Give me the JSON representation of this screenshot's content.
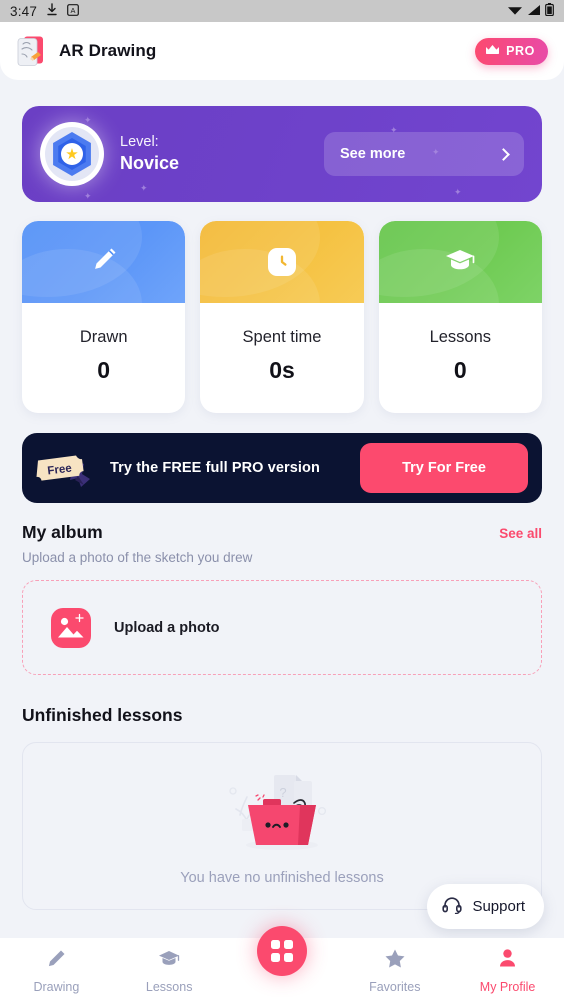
{
  "status_bar": {
    "time": "3:47",
    "icons_left": [
      "download-icon",
      "a-badge-icon"
    ],
    "icons_right": [
      "wifi-icon",
      "signal-icon",
      "battery-icon"
    ]
  },
  "header": {
    "app_icon": "ar-drawing-app-icon",
    "title": "AR Drawing",
    "pro_label": "PRO",
    "pro_icon": "crown-icon",
    "pro_color": "#f2479a"
  },
  "level_card": {
    "badge_icon": "level-badge-star-icon",
    "label": "Level:",
    "value": "Novice",
    "button_label": "See more",
    "button_icon": "chevron-right-icon",
    "bg_color": "#6d41c9"
  },
  "stats": [
    {
      "icon": "pencil-icon",
      "label": "Drawn",
      "value": "0",
      "color": "#4f8ef7"
    },
    {
      "icon": "clock-icon",
      "label": "Spent time",
      "value": "0s",
      "color": "#f2b731"
    },
    {
      "icon": "graduation-cap-icon",
      "label": "Lessons",
      "value": "0",
      "color": "#62c447"
    }
  ],
  "promo": {
    "ticket_icon": "free-ticket-icon",
    "ticket_text": "Free",
    "text": "Try the FREE full PRO version",
    "button_label": "Try For Free",
    "bg_color": "#0b1332",
    "button_color": "#fc4a6e"
  },
  "album": {
    "title": "My album",
    "see_all": "See all",
    "subtitle": "Upload a photo of the sketch you drew",
    "upload_icon": "add-photo-icon",
    "upload_label": "Upload a photo"
  },
  "unfinished": {
    "title": "Unfinished lessons",
    "illustration": "empty-basket-illustration",
    "empty_text": "You have no unfinished lessons"
  },
  "support": {
    "icon": "headset-icon",
    "label": "Support"
  },
  "bottom_nav": {
    "items": [
      {
        "icon": "pencil-icon",
        "label": "Drawing",
        "active": false
      },
      {
        "icon": "graduation-cap-icon",
        "label": "Lessons",
        "active": false
      },
      {
        "icon": "grid-icon",
        "label": "",
        "active": false
      },
      {
        "icon": "star-icon",
        "label": "Favorites",
        "active": false
      },
      {
        "icon": "person-icon",
        "label": "My Profile",
        "active": true
      }
    ],
    "active_color": "#fb4a6e",
    "inactive_color": "#9aa0bb"
  }
}
